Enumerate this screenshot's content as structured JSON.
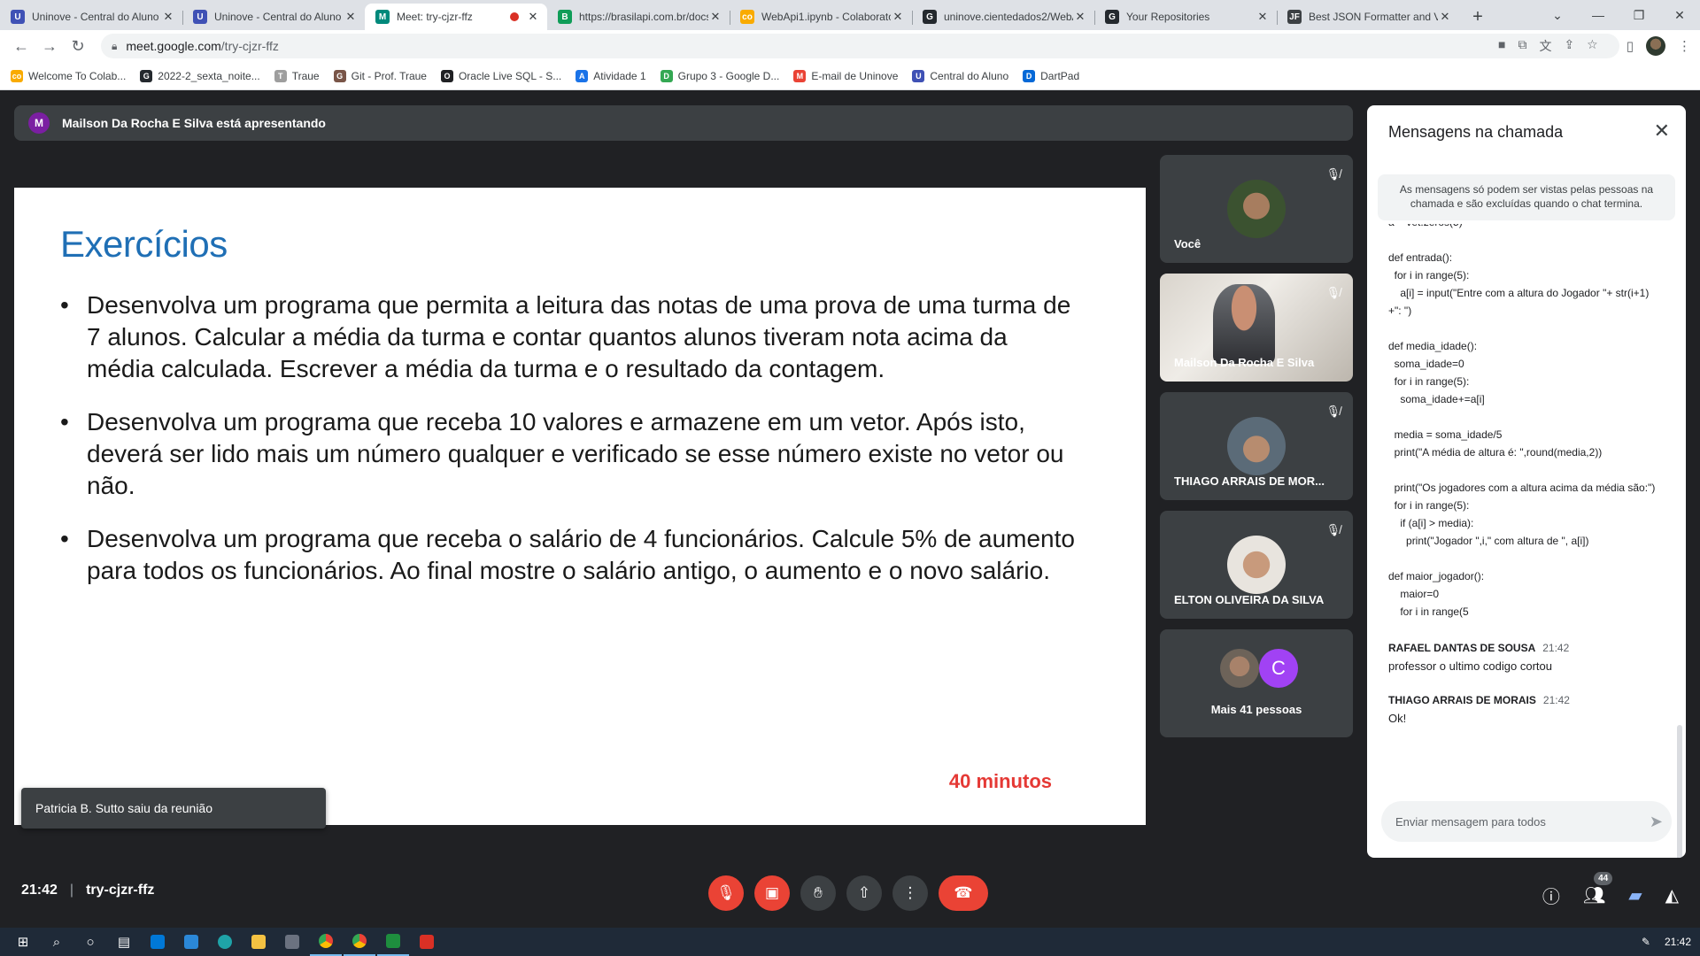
{
  "browser": {
    "tabs": [
      {
        "title": "Uninove - Central do Aluno",
        "color": "#3f51b5",
        "glyph": "U"
      },
      {
        "title": "Uninove - Central do Aluno",
        "color": "#3f51b5",
        "glyph": "U"
      },
      {
        "title": "Meet: try-cjzr-ffz",
        "color": "#00897b",
        "glyph": "M",
        "active": true
      },
      {
        "title": "https://brasilapi.com.br/docs",
        "color": "#0f9d58",
        "glyph": "B"
      },
      {
        "title": "WebApi1.ipynb - Colaboratory",
        "color": "#f9ab00",
        "glyph": "co"
      },
      {
        "title": "uninove.cientedados2/WebApi",
        "color": "#24292e",
        "glyph": "G"
      },
      {
        "title": "Your Repositories",
        "color": "#24292e",
        "glyph": "G"
      },
      {
        "title": "Best JSON Formatter and Validator",
        "color": "#3c4043",
        "glyph": "JF"
      }
    ],
    "new_tab": "+",
    "url_host": "meet.google.com",
    "url_path": "/try-cjzr-ffz",
    "bookmarks": [
      {
        "label": "Welcome To Colab...",
        "color": "#f9ab00",
        "glyph": "co"
      },
      {
        "label": "2022-2_sexta_noite...",
        "color": "#24292e",
        "glyph": "G"
      },
      {
        "label": "Traue",
        "color": "#9e9e9e",
        "glyph": "T"
      },
      {
        "label": "Git - Prof. Traue",
        "color": "#795548",
        "glyph": "G"
      },
      {
        "label": "Oracle Live SQL - S...",
        "color": "#202124",
        "glyph": "O"
      },
      {
        "label": "Atividade 1",
        "color": "#1a73e8",
        "glyph": "A"
      },
      {
        "label": "Grupo 3 - Google D...",
        "color": "#34a853",
        "glyph": "D"
      },
      {
        "label": "E-mail de Uninove",
        "color": "#ea4335",
        "glyph": "M"
      },
      {
        "label": "Central do Aluno",
        "color": "#3f51b5",
        "glyph": "U"
      },
      {
        "label": "DartPad",
        "color": "#0468d7",
        "glyph": "D"
      }
    ]
  },
  "meet": {
    "presenter_initial": "M",
    "presenter_text": "Mailson Da Rocha E Silva está apresentando",
    "slide": {
      "title": "Exercícios",
      "bullets": [
        "Desenvolva um programa que permita a leitura das notas de uma prova de uma turma de 7 alunos. Calcular a média da turma e contar quantos alunos tiveram nota acima da média calculada. Escrever a média da turma e o resultado da contagem.",
        "Desenvolva um programa que receba 10 valores e armazene em um vetor. Após isto, deverá ser lido mais um número qualquer e verificado se esse número existe no vetor ou não.",
        "Desenvolva um programa que receba o salário de 4 funcionários. Calcule 5% de aumento para todos os funcionários. Ao final mostre o salário antigo, o aumento e o novo salário."
      ],
      "timer": "40 minutos"
    },
    "toast": "Patricia B. Sutto saiu da reunião",
    "tiles": [
      {
        "name": "Você"
      },
      {
        "name": "Mailson Da Rocha E Silva"
      },
      {
        "name": "THIAGO ARRAIS DE MOR..."
      },
      {
        "name": "ELTON OLIVEIRA DA SILVA"
      },
      {
        "name": "Mais 41 pessoas",
        "extra_initial": "C"
      }
    ],
    "time": "21:42",
    "meeting_code": "try-cjzr-ffz",
    "participant_count": "44"
  },
  "chat": {
    "title": "Mensagens na chamada",
    "note": "As mensagens só podem ser vistas pelas pessoas na chamada e são excluídas quando o chat termina.",
    "code": "a = vet.zeros(5)\n\ndef entrada():\n  for i in range(5):\n    a[i] = input(\"Entre com a altura do Jogador \"+ str(i+1) +\": \")\n\ndef media_idade():\n  soma_idade=0\n  for i in range(5):\n    soma_idade+=a[i]\n\n  media = soma_idade/5\n  print(\"A média de altura é: \",round(media,2))\n\n  print(\"Os jogadores com a altura acima da média são:\")\n  for i in range(5):\n    if (a[i] > media):\n      print(\"Jogador \",i,\" com altura de \", a[i])\n\ndef maior_jogador():\n    maior=0\n    for i in range(5",
    "messages": [
      {
        "author": "RAFAEL DANTAS DE SOUSA",
        "time": "21:42",
        "text": "professor o ultimo codigo cortou"
      },
      {
        "author": "THIAGO ARRAIS DE MORAIS",
        "time": "21:42",
        "text": "Ok!"
      }
    ],
    "input_placeholder": "Enviar mensagem para todos"
  },
  "taskbar": {
    "clock": "21:42"
  }
}
